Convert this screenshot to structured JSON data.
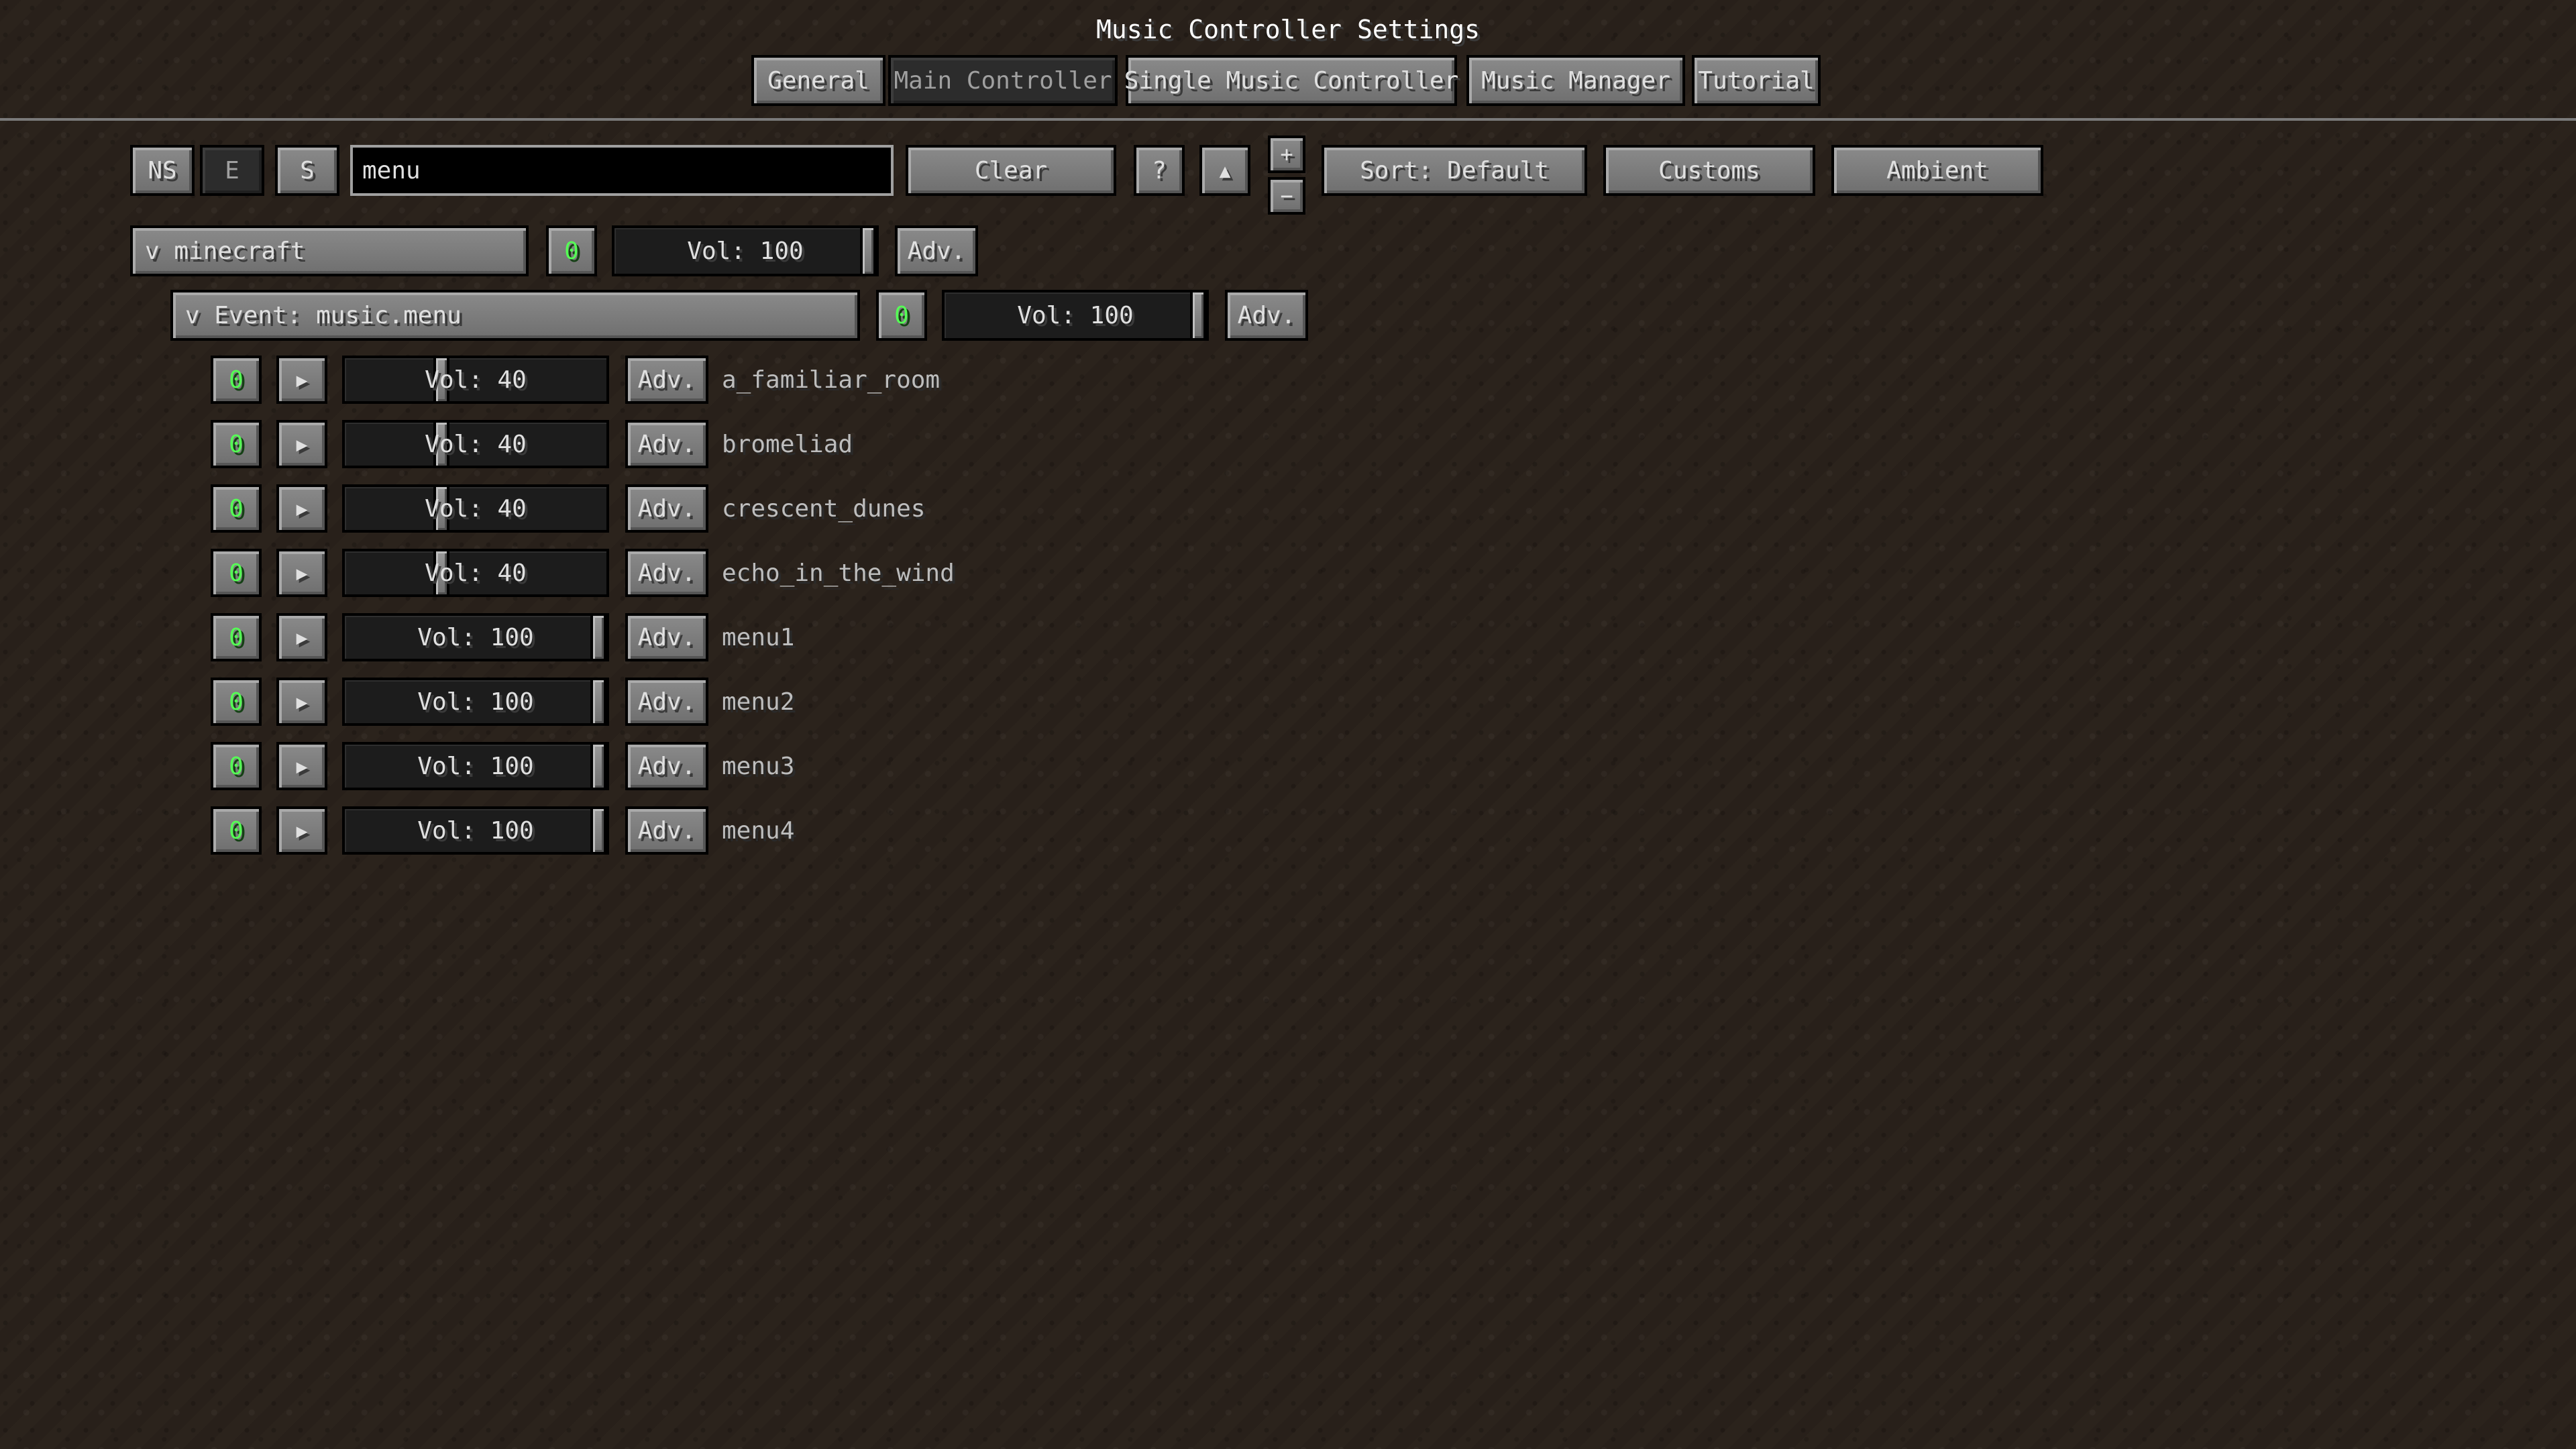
{
  "header": {
    "title": "Music Controller Settings",
    "tabs": [
      {
        "label": "General",
        "active": false
      },
      {
        "label": "Main Controller",
        "active": true
      },
      {
        "label": "Single Music Controller",
        "active": false
      },
      {
        "label": "Music Manager",
        "active": false
      },
      {
        "label": "Tutorial",
        "active": false
      }
    ]
  },
  "toolbar": {
    "ns_label": "NS",
    "e_label": "E",
    "s_label": "S",
    "search_value": "menu",
    "clear_label": "Clear",
    "help_label": "?",
    "up_label": "▲",
    "plus_label": "+",
    "minus_label": "−",
    "sort_label": "Sort: Default",
    "customs_label": "Customs",
    "ambient_label": "Ambient"
  },
  "group": {
    "name": "v minecraft",
    "count": "0",
    "volume_label": "Vol: 100",
    "volume": 100,
    "adv_label": "Adv."
  },
  "event": {
    "name": "v Event: music.menu",
    "count": "0",
    "volume_label": "Vol: 100",
    "volume": 100,
    "adv_label": "Adv."
  },
  "tracks": [
    {
      "count": "0",
      "play": "▶",
      "volume_label": "Vol: 40",
      "volume": 40,
      "adv": "Adv.",
      "name": "a_familiar_room"
    },
    {
      "count": "0",
      "play": "▶",
      "volume_label": "Vol: 40",
      "volume": 40,
      "adv": "Adv.",
      "name": "bromeliad"
    },
    {
      "count": "0",
      "play": "▶",
      "volume_label": "Vol: 40",
      "volume": 40,
      "adv": "Adv.",
      "name": "crescent_dunes"
    },
    {
      "count": "0",
      "play": "▶",
      "volume_label": "Vol: 40",
      "volume": 40,
      "adv": "Adv.",
      "name": "echo_in_the_wind"
    },
    {
      "count": "0",
      "play": "▶",
      "volume_label": "Vol: 100",
      "volume": 100,
      "adv": "Adv.",
      "name": "menu1"
    },
    {
      "count": "0",
      "play": "▶",
      "volume_label": "Vol: 100",
      "volume": 100,
      "adv": "Adv.",
      "name": "menu2"
    },
    {
      "count": "0",
      "play": "▶",
      "volume_label": "Vol: 100",
      "volume": 100,
      "adv": "Adv.",
      "name": "menu3"
    },
    {
      "count": "0",
      "play": "▶",
      "volume_label": "Vol: 100",
      "volume": 100,
      "adv": "Adv.",
      "name": "menu4"
    }
  ],
  "colors": {
    "count_text": "#55ff55",
    "background": "#2b231c"
  }
}
